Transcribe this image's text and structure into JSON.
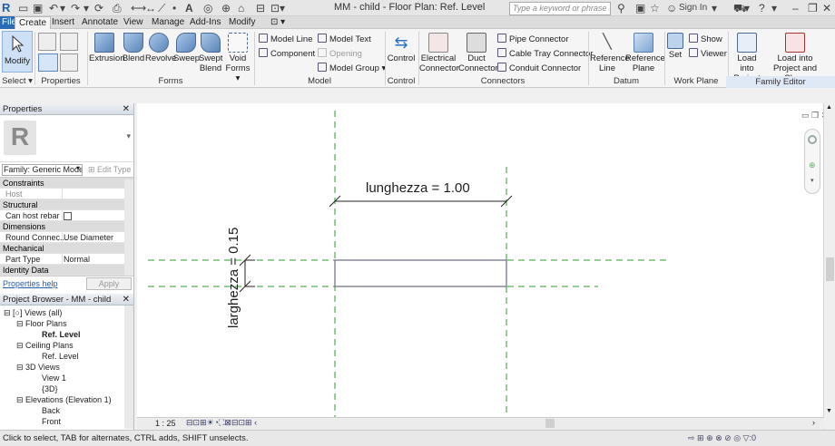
{
  "app": {
    "title": "MM - child - Floor Plan: Ref. Level"
  },
  "search": {
    "placeholder": "Type a keyword or phrase"
  },
  "account": {
    "sign_in": "Sign In"
  },
  "tabs": [
    {
      "label": "File"
    },
    {
      "label": "Create"
    },
    {
      "label": "Insert"
    },
    {
      "label": "Annotate"
    },
    {
      "label": "View"
    },
    {
      "label": "Manage"
    },
    {
      "label": "Add-Ins"
    },
    {
      "label": "Modify"
    }
  ],
  "ribbon": {
    "select": {
      "modify": "Modify",
      "panel": "Select"
    },
    "properties_panel": "Properties",
    "forms": {
      "extrusion": "Extrusion",
      "blend": "Blend",
      "revolve": "Revolve",
      "sweep": "Sweep",
      "swept_blend_1": "Swept",
      "swept_blend_2": "Blend",
      "void_forms_1": "Void",
      "void_forms_2": "Forms",
      "panel": "Forms"
    },
    "model": {
      "model_line": "Model Line",
      "model_text": "Model Text",
      "component": "Component",
      "opening": "Opening",
      "model_group": "Model Group",
      "panel": "Model"
    },
    "control": {
      "control": "Control",
      "panel": "Control"
    },
    "connectors": {
      "electrical_1": "Electrical",
      "electrical_2": "Connector",
      "duct_1": "Duct",
      "duct_2": "Connector",
      "pipe": "Pipe Connector",
      "cable_tray": "Cable Tray Connector",
      "conduit": "Conduit Connector",
      "panel": "Connectors"
    },
    "datum": {
      "ref_line_1": "Reference",
      "ref_line_2": "Line",
      "ref_plane_1": "Reference",
      "ref_plane_2": "Plane",
      "panel": "Datum"
    },
    "work_plane": {
      "set": "Set",
      "show": "Show",
      "viewer": "Viewer",
      "panel": "Work Plane"
    },
    "family_editor": {
      "load_1": "Load into",
      "load_2": "Project",
      "load_close_1": "Load into",
      "load_close_2": "Project and Close",
      "panel": "Family Editor"
    }
  },
  "properties": {
    "title": "Properties",
    "family_selector": "Family: Generic Mode",
    "edit_type": "Edit Type",
    "rows": [
      {
        "type": "cat",
        "label": "Constraints"
      },
      {
        "type": "row",
        "key": "Host",
        "value": ""
      },
      {
        "type": "cat",
        "label": "Structural"
      },
      {
        "type": "row",
        "key": "Can host rebar",
        "value": ""
      },
      {
        "type": "cat",
        "label": "Dimensions"
      },
      {
        "type": "row",
        "key": "Round Connec...",
        "value": "Use Diameter"
      },
      {
        "type": "cat",
        "label": "Mechanical"
      },
      {
        "type": "row",
        "key": "Part Type",
        "value": "Normal"
      },
      {
        "type": "cat",
        "label": "Identity Data"
      }
    ],
    "help": "Properties help",
    "apply": "Apply"
  },
  "project_browser": {
    "title": "Project Browser - MM - child",
    "nodes": [
      {
        "label": "Views (all)"
      },
      {
        "label": "Floor Plans"
      },
      {
        "label": "Ref. Level"
      },
      {
        "label": "Ceiling Plans"
      },
      {
        "label": "Ref. Level"
      },
      {
        "label": "3D Views"
      },
      {
        "label": "View 1"
      },
      {
        "label": "{3D}"
      },
      {
        "label": "Elevations (Elevation 1)"
      },
      {
        "label": "Back"
      },
      {
        "label": "Front"
      }
    ]
  },
  "canvas": {
    "dim_length": "lunghezza = 1.00",
    "dim_width": "larghezza = 0.15"
  },
  "view_control": {
    "scale": "1 : 25"
  },
  "status": {
    "message": "Click to select, TAB for alternates, CTRL adds, SHIFT unselects.",
    "filter_count": ":0"
  }
}
